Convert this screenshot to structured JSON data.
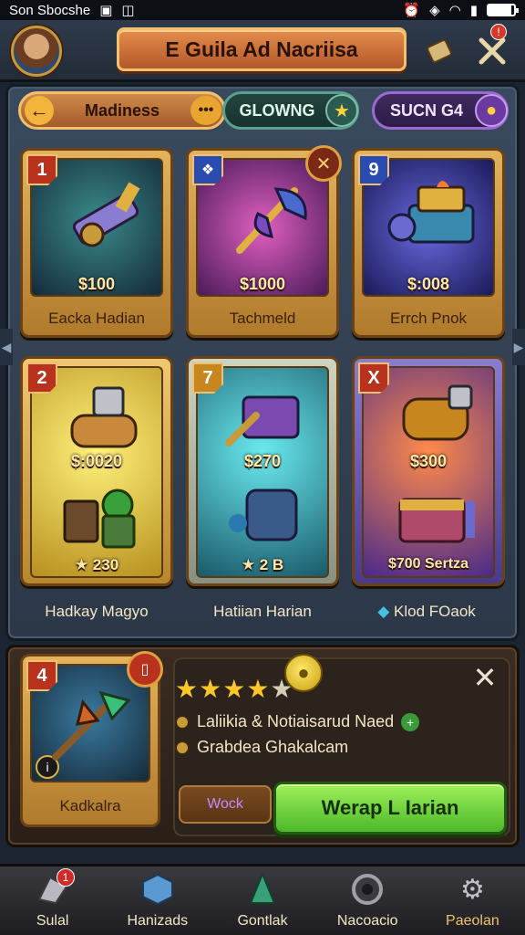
{
  "status_bar": {
    "carrier": "Son Sbocshe",
    "battery_level": 0.9
  },
  "header": {
    "title": "E Guila Ad Nacriisa"
  },
  "tabs": [
    {
      "label": "Madiness"
    },
    {
      "label": "GLOWNG"
    },
    {
      "label": "SUCN G4"
    }
  ],
  "cards": [
    {
      "number": "1",
      "price": "$100",
      "name": "Eacka Hadian"
    },
    {
      "number": "",
      "price": "$1000",
      "name": "Tachmeld"
    },
    {
      "number": "9",
      "price": "$:008",
      "name": "Errch Pnok"
    },
    {
      "number": "2",
      "price": "$:0020",
      "sub_price": "230"
    },
    {
      "number": "7",
      "price": "$270",
      "sub_price": "2 B"
    },
    {
      "number": "X",
      "price": "$300",
      "sub_price": "$700 Sertza"
    }
  ],
  "card_labels": [
    "Hadkay Magyo",
    "Hatiian Harian",
    "Klod FOaok"
  ],
  "detail": {
    "number": "4",
    "name": "Kadkalra",
    "rating": 4,
    "rating_max": 5,
    "line1": "Laliikia & Notiaisarud Naed",
    "line2": "Grabdea Ghakalcam",
    "secondary_button": "Wock",
    "primary_button": "Werap L Iarian"
  },
  "bottom_nav": [
    {
      "label": "Sulal",
      "badge": "1",
      "icon": "chest-icon"
    },
    {
      "label": "Hanizads",
      "icon": "cube-icon"
    },
    {
      "label": "Gontlak",
      "icon": "crystal-icon"
    },
    {
      "label": "Nacoacio",
      "icon": "ring-icon"
    },
    {
      "label": "Paeolan",
      "icon": "gear-icon"
    }
  ]
}
